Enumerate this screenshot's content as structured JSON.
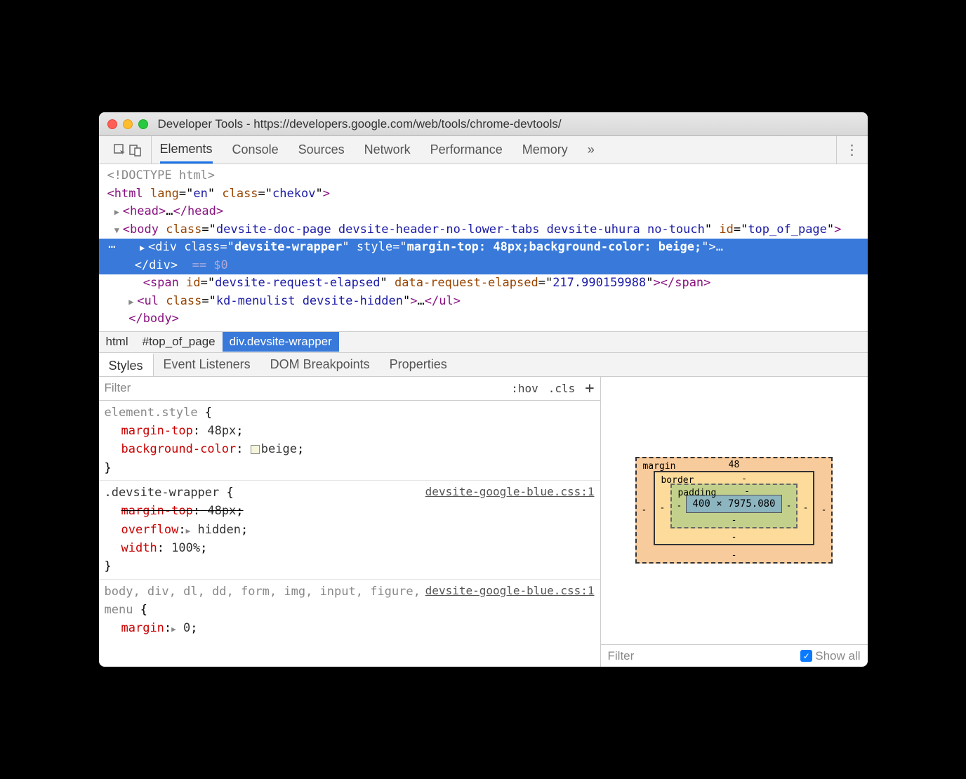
{
  "window": {
    "title": "Developer Tools - https://developers.google.com/web/tools/chrome-devtools/"
  },
  "main_tabs": [
    "Elements",
    "Console",
    "Sources",
    "Network",
    "Performance",
    "Memory"
  ],
  "more_tabs_icon": "»",
  "dom": {
    "doctype": "<!DOCTYPE html>",
    "html_open": {
      "tag": "html",
      "lang": "en",
      "class": "chekov"
    },
    "head": {
      "tag": "head"
    },
    "body": {
      "tag": "body",
      "class": "devsite-doc-page devsite-header-no-lower-tabs devsite-uhura no-touch",
      "id": "top_of_page"
    },
    "selected": {
      "tag": "div",
      "class": "devsite-wrapper",
      "style": "margin-top: 48px;background-color: beige;",
      "close": "</div>",
      "marker": "== $0"
    },
    "span": {
      "tag": "span",
      "id": "devsite-request-elapsed",
      "data_attr": "data-request-elapsed",
      "data_val": "217.990159988"
    },
    "ul": {
      "tag": "ul",
      "class": "kd-menulist devsite-hidden"
    },
    "body_close": "</body>"
  },
  "breadcrumb": [
    "html",
    "#top_of_page",
    "div.devsite-wrapper"
  ],
  "style_tabs": [
    "Styles",
    "Event Listeners",
    "DOM Breakpoints",
    "Properties"
  ],
  "filter": {
    "placeholder": "Filter",
    "hov": ":hov",
    "cls": ".cls",
    "plus": "+"
  },
  "rules": {
    "element_style": {
      "selector": "element.style",
      "props": [
        {
          "name": "margin-top",
          "value": "48px"
        },
        {
          "name": "background-color",
          "value": "beige",
          "swatch": true
        }
      ]
    },
    "devsite_wrapper": {
      "selector": ".devsite-wrapper",
      "source": "devsite-google-blue.css:1",
      "props": [
        {
          "name": "margin-top",
          "value": "48px",
          "strike": true
        },
        {
          "name": "overflow",
          "value": "hidden",
          "expand": true
        },
        {
          "name": "width",
          "value": "100%"
        }
      ]
    },
    "reset": {
      "selector": "body, div, dl, dd, form, img, input, figure, menu",
      "source": "devsite-google-blue.css:1",
      "props": [
        {
          "name": "margin",
          "value": "0",
          "expand": true,
          "cut": true
        }
      ]
    }
  },
  "box_model": {
    "margin_label": "margin",
    "margin_top": "48",
    "border_label": "border",
    "padding_label": "padding",
    "content": "400 × 7975.080",
    "dash": "-"
  },
  "computed": {
    "filter": "Filter",
    "show_all": "Show all"
  }
}
